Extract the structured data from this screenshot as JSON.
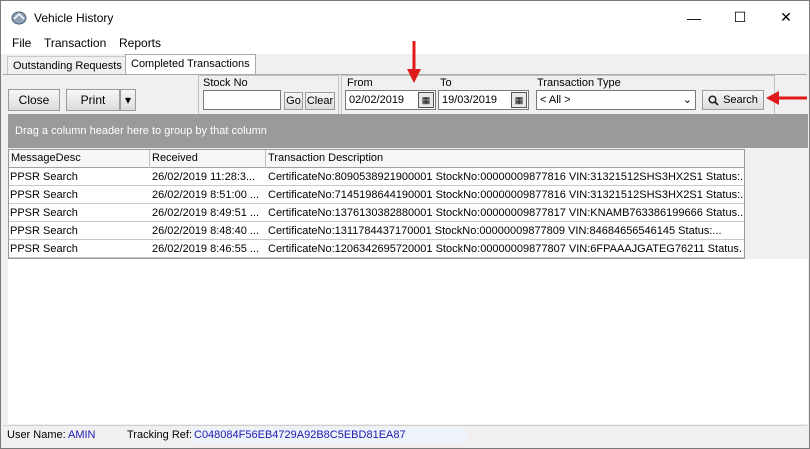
{
  "window": {
    "title": "Vehicle History",
    "controls": {
      "minimize": "—",
      "maximize": "☐",
      "close": "✕"
    }
  },
  "menu": {
    "items": [
      "File",
      "Transaction",
      "Reports"
    ]
  },
  "tabs": [
    {
      "label": "Outstanding Requests",
      "active": false
    },
    {
      "label": "Completed Transactions",
      "active": true
    }
  ],
  "toolbar": {
    "close_label": "Close",
    "print_label": "Print",
    "print_dropdown": "▾",
    "stock_no": {
      "label": "Stock No",
      "value": ""
    },
    "go_label": "Go",
    "clear_label": "Clear",
    "from": {
      "label": "From",
      "value": "02/02/2019"
    },
    "to": {
      "label": "To",
      "value": "19/03/2019"
    },
    "transaction_type": {
      "label": "Transaction Type",
      "value": "< All >"
    },
    "search_label": "Search"
  },
  "group_panel": {
    "hint": "Drag a column header here to group by that column"
  },
  "grid": {
    "columns": [
      "MessageDesc",
      "Received",
      "Transaction Description"
    ],
    "rows": [
      [
        "PPSR Search",
        "26/02/2019 11:28:3...",
        "CertificateNo:8090538921900001 StockNo:00000009877816  VIN:31321512SHS3HX2S1 Status:..."
      ],
      [
        "PPSR Search",
        "26/02/2019 8:51:00 ...",
        "CertificateNo:7145198644190001 StockNo:00000009877816  VIN:31321512SHS3HX2S1 Status:..."
      ],
      [
        "PPSR Search",
        "26/02/2019 8:49:51 ...",
        "CertificateNo:1376130382880001 StockNo:00000009877817  VIN:KNAMB763386199666 Status..."
      ],
      [
        "PPSR Search",
        "26/02/2019 8:48:40 ...",
        "CertificateNo:1311784437170001 StockNo:00000009877809  VIN:84684656546145 Status:..."
      ],
      [
        "PPSR Search",
        "26/02/2019 8:46:55 ...",
        "CertificateNo:1206342695720001 StockNo:00000009877807  VIN:6FPAAAJGATEG76211 Status..."
      ]
    ]
  },
  "status": {
    "user_label": "User Name:",
    "user_value": "AMIN",
    "tracking_label": "Tracking Ref:",
    "tracking_value": "C048084F56EB4729A92B8C5EBD81EA87"
  },
  "colors": {
    "annotation_arrow": "#e01b1b",
    "status_value": "#1a1ab0",
    "group_panel": "#9a9a9a"
  }
}
